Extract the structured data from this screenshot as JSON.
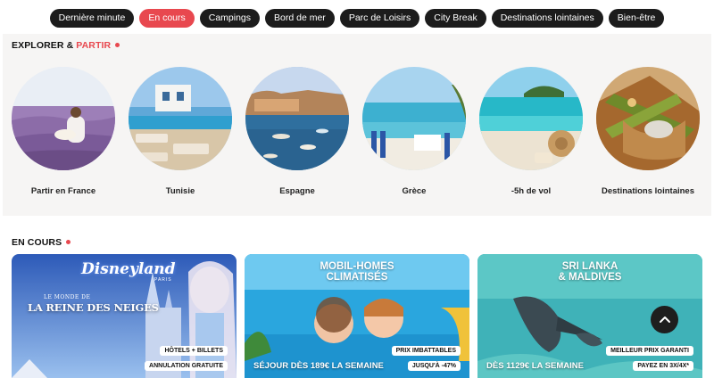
{
  "nav": {
    "pills": [
      {
        "label": "Dernière minute",
        "active": false
      },
      {
        "label": "En cours",
        "active": true
      },
      {
        "label": "Campings",
        "active": false
      },
      {
        "label": "Bord de mer",
        "active": false
      },
      {
        "label": "Parc de Loisirs",
        "active": false
      },
      {
        "label": "City Break",
        "active": false
      },
      {
        "label": "Destinations lointaines",
        "active": false
      },
      {
        "label": "Bien-être",
        "active": false
      }
    ]
  },
  "explore": {
    "title_part1": "EXPLORER & ",
    "title_part2": "PARTIR",
    "destinations": [
      {
        "label": "Partir en France"
      },
      {
        "label": "Tunisie"
      },
      {
        "label": "Espagne"
      },
      {
        "label": "Grèce"
      },
      {
        "label": "-5h de vol"
      },
      {
        "label": "Destinations lointaines"
      }
    ]
  },
  "en_cours": {
    "title": "EN COURS",
    "cards": [
      {
        "logo": "Disneyland",
        "logo_sub": "PARIS",
        "subtitle_small": "LE MONDE DE",
        "subtitle_big": "LA REINE DES NEIGES",
        "tags": [
          "HÔTELS + BILLETS",
          "ANNULATION GRATUITE"
        ]
      },
      {
        "title_line1": "MOBIL-HOMES",
        "title_line2": "CLIMATISÉS",
        "promo": "SÉJOUR DÈS 189€ LA SEMAINE",
        "tags": [
          "PRIX IMBATTABLES",
          "JUSQU'À -47%"
        ]
      },
      {
        "title_line1": "SRI LANKA",
        "title_line2": "& MALDIVES",
        "promo": "DÈS 1129€ LA SEMAINE",
        "tags": [
          "MEILLEUR PRIX GARANTI",
          "PAYEZ EN 3X/4X*"
        ]
      }
    ]
  },
  "colors": {
    "accent": "#e8484f",
    "pill_dark": "#1c1c1c",
    "section_bg": "#f6f5f4"
  }
}
